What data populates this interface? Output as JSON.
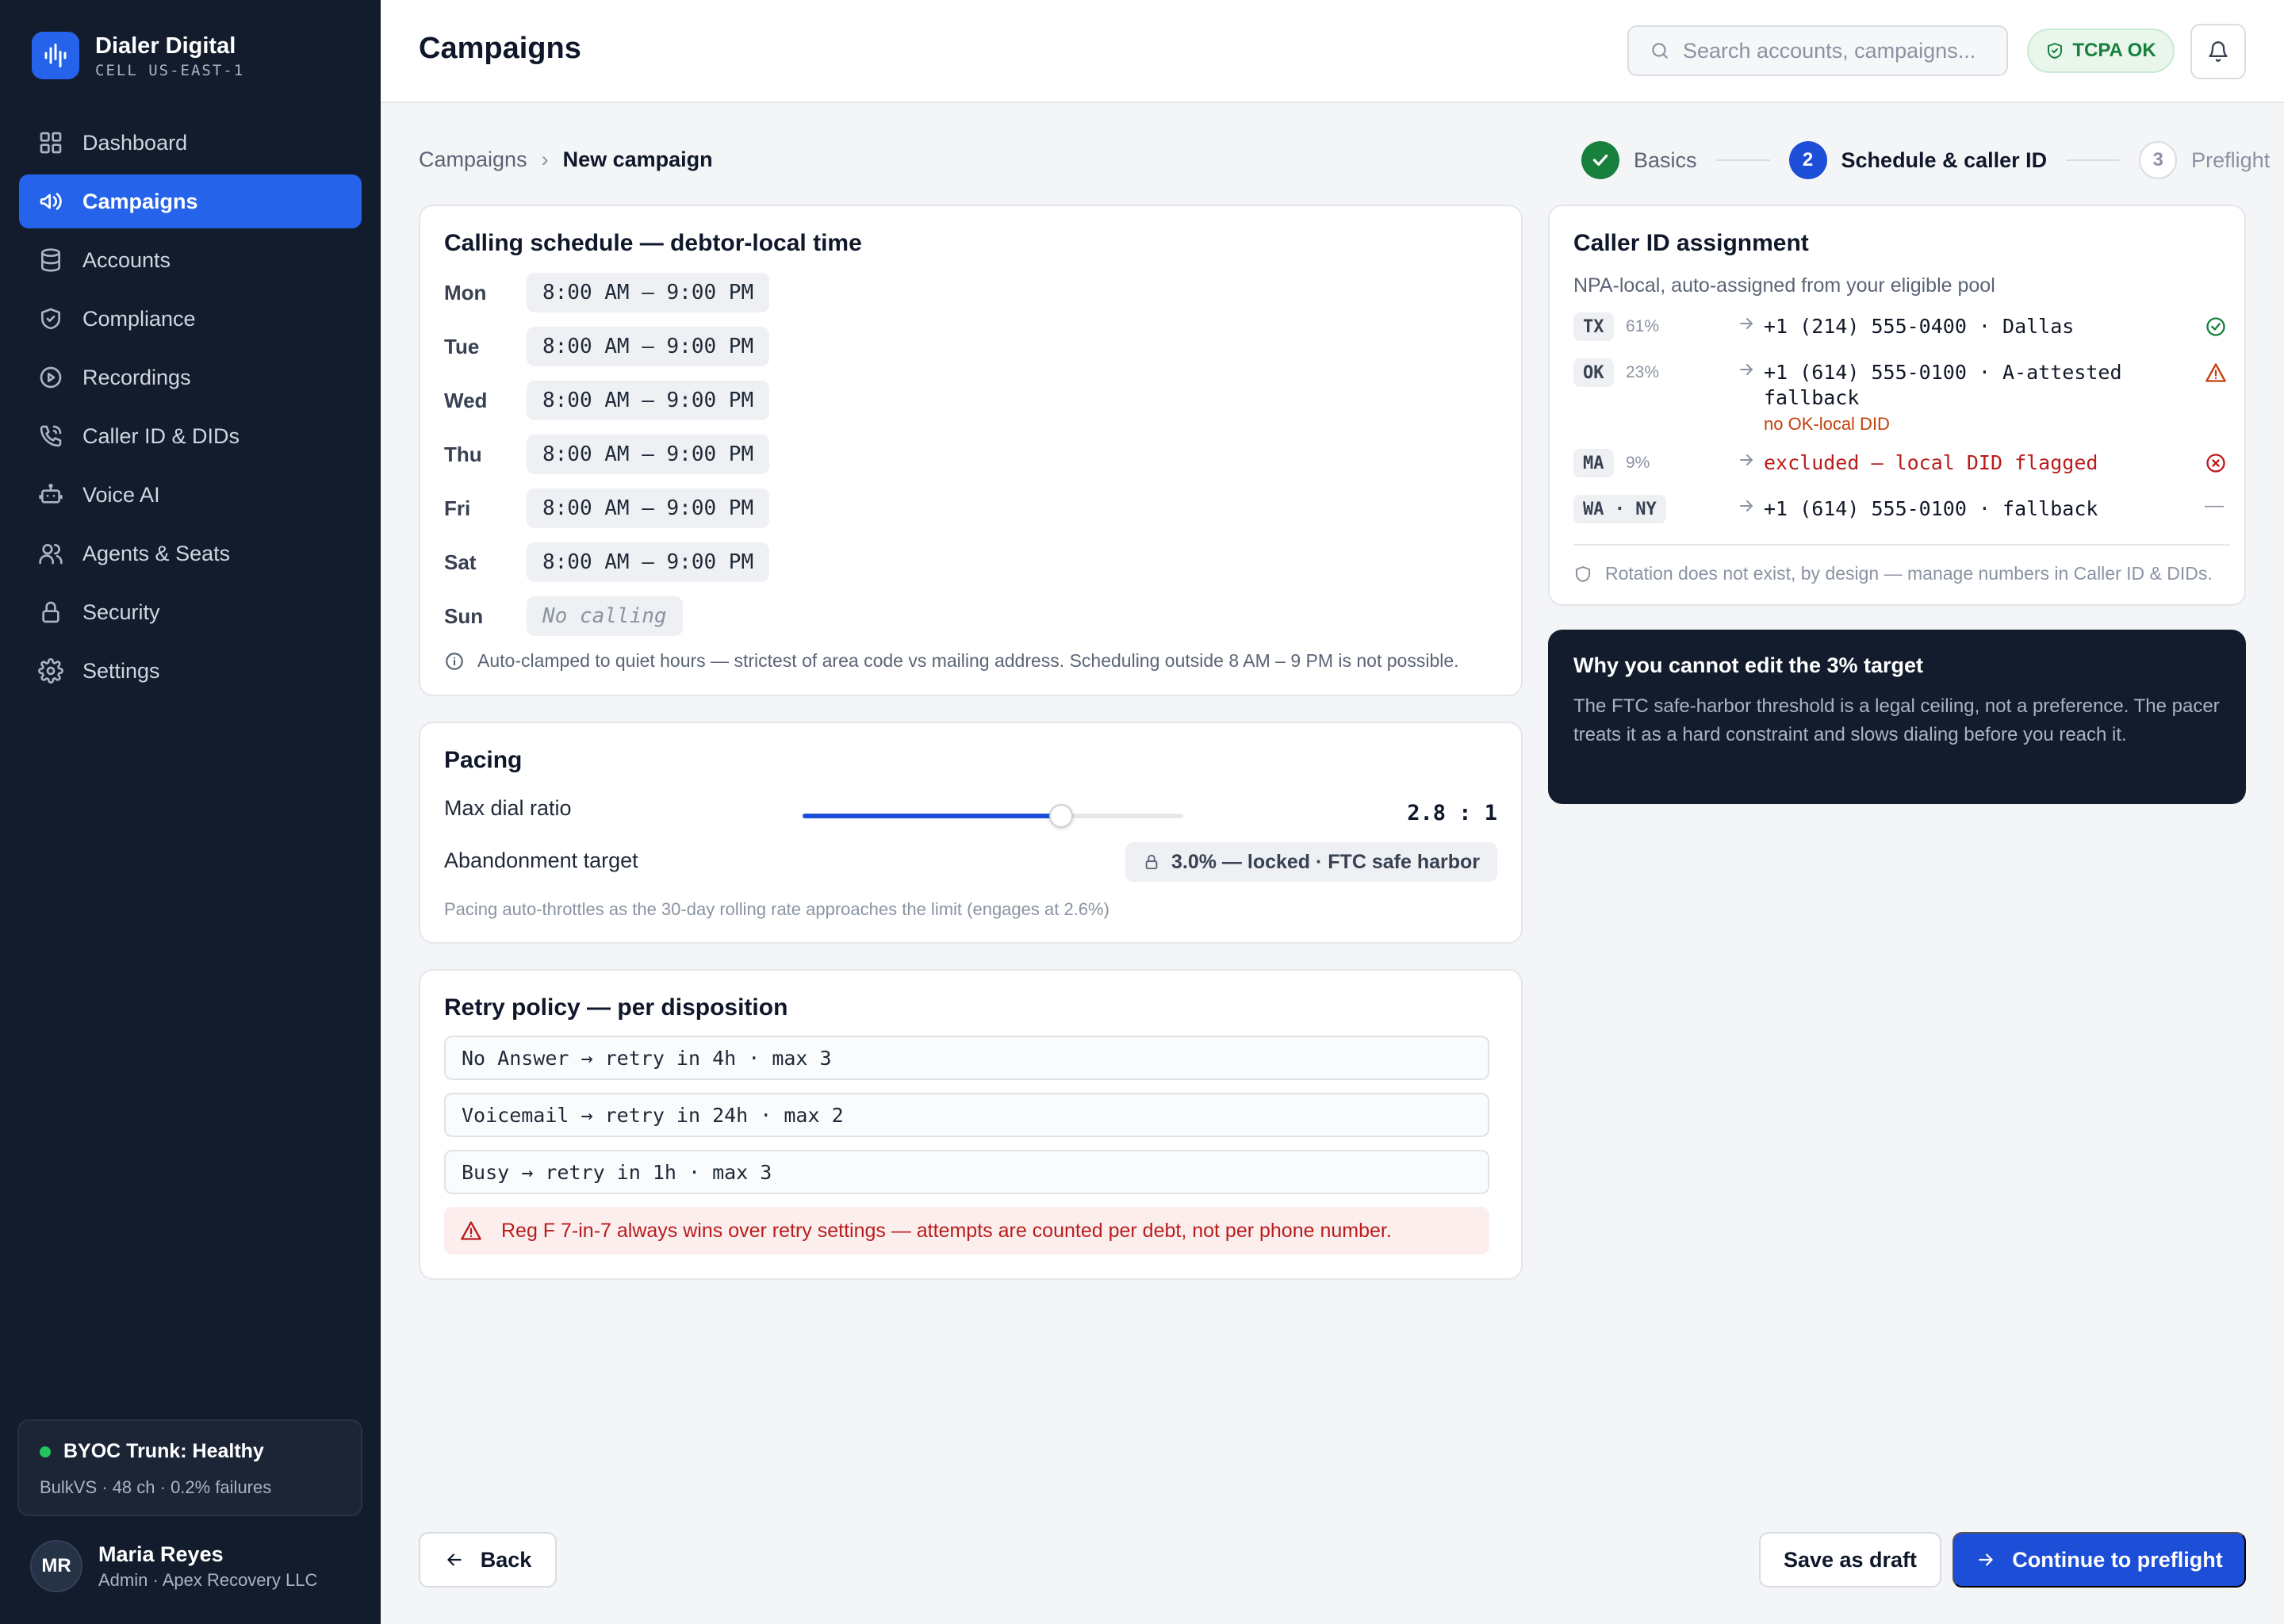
{
  "brand": {
    "name": "Dialer Digital",
    "cell": "CELL US-EAST-1"
  },
  "nav": [
    {
      "label": "Dashboard",
      "icon": "dashboard-icon"
    },
    {
      "label": "Campaigns",
      "icon": "megaphone-icon",
      "active": true
    },
    {
      "label": "Accounts",
      "icon": "database-icon"
    },
    {
      "label": "Compliance",
      "icon": "shield-icon"
    },
    {
      "label": "Recordings",
      "icon": "play-circle-icon"
    },
    {
      "label": "Caller ID & DIDs",
      "icon": "phone-icon"
    },
    {
      "label": "Voice AI",
      "icon": "robot-icon"
    },
    {
      "label": "Agents & Seats",
      "icon": "users-icon"
    },
    {
      "label": "Security",
      "icon": "lock-icon"
    },
    {
      "label": "Settings",
      "icon": "gear-icon"
    }
  ],
  "trunk": {
    "title": "BYOC Trunk: Healthy",
    "detail": "BulkVS · 48 ch · 0.2% failures",
    "status_color": "#22c55e"
  },
  "user": {
    "initials": "MR",
    "name": "Maria Reyes",
    "role": "Admin · Apex Recovery LLC"
  },
  "header": {
    "title": "Campaigns",
    "search_placeholder": "Search accounts, campaigns...",
    "badge": "TCPA OK"
  },
  "breadcrumb": {
    "parent": "Campaigns",
    "separator": "›",
    "current": "New campaign"
  },
  "stepper": [
    {
      "label": "Basics",
      "state": "done",
      "number": "1"
    },
    {
      "label": "Schedule & caller ID",
      "state": "current",
      "number": "2"
    },
    {
      "label": "Preflight",
      "state": "todo",
      "number": "3"
    }
  ],
  "schedule": {
    "title": "Calling schedule — debtor-local time",
    "days": [
      {
        "day": "Mon",
        "hours": "8:00 AM – 9:00 PM"
      },
      {
        "day": "Tue",
        "hours": "8:00 AM – 9:00 PM"
      },
      {
        "day": "Wed",
        "hours": "8:00 AM – 9:00 PM"
      },
      {
        "day": "Thu",
        "hours": "8:00 AM – 9:00 PM"
      },
      {
        "day": "Fri",
        "hours": "8:00 AM – 9:00 PM"
      },
      {
        "day": "Sat",
        "hours": "8:00 AM – 9:00 PM"
      },
      {
        "day": "Sun",
        "hours": "No calling"
      }
    ],
    "note": "Auto-clamped to quiet hours — strictest of area code vs mailing address. Scheduling outside 8 AM – 9 PM is not possible."
  },
  "pacing": {
    "title": "Pacing",
    "ratio_label": "Max dial ratio",
    "ratio_value": "2.8 : 1",
    "slider_fraction": 0.68,
    "target_label": "Abandonment target",
    "target_value": "3.0% — locked · FTC safe harbor",
    "note": "Pacing auto-throttles as the 30-day rolling rate approaches the limit (engages at 2.6%)"
  },
  "retry": {
    "title": "Retry policy — per disposition",
    "rows": [
      "No Answer → retry in 4h · max 3",
      "Voicemail → retry in 24h · max 2",
      "Busy → retry in 1h · max 3"
    ],
    "alert": "Reg F 7-in-7 always wins over retry settings — attempts are counted per debt, not per phone number."
  },
  "caller_id": {
    "title": "Caller ID assignment",
    "subtitle": "NPA-local, auto-assigned from your eligible pool",
    "rows": [
      {
        "state": "TX",
        "pct": "61%",
        "number": "+1 (214) 555-0400 · Dallas",
        "status": "ok"
      },
      {
        "state": "OK",
        "pct": "23%",
        "number": "+1 (614) 555-0100 · A-attested fallback",
        "note": "no OK-local DID",
        "status": "warning"
      },
      {
        "state": "MA",
        "pct": "9%",
        "number": "excluded — local DID flagged",
        "status": "error"
      },
      {
        "state": "WA · NY",
        "pct": "",
        "number": "+1 (614) 555-0100 · fallback",
        "status": "—"
      }
    ],
    "footer": "Rotation does not exist, by design — manage numbers in Caller ID & DIDs."
  },
  "explainer": {
    "title": "Why you cannot edit the 3% target",
    "body": "The FTC safe-harbor threshold is a legal ceiling, not a preference. The pacer treats it as a hard constraint and slows dialing before you reach it."
  },
  "footer": {
    "back": "Back",
    "draft": "Save as draft",
    "continue": "Continue to preflight"
  },
  "colors": {
    "accent": "#1d4ed8",
    "sidebar": "#131c2c",
    "success": "#17803d",
    "warning": "#c2410c",
    "danger": "#b91c1c"
  }
}
